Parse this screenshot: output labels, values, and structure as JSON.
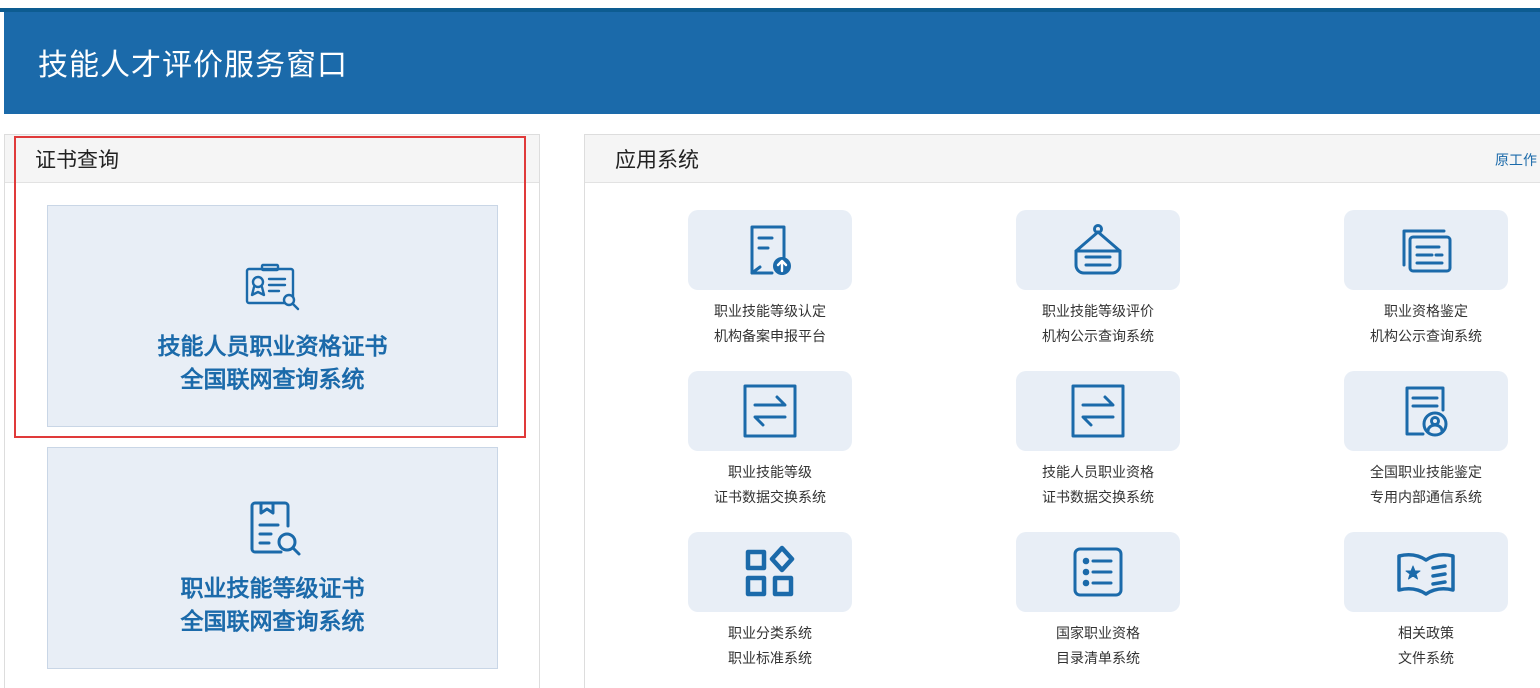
{
  "header": {
    "title": "技能人才评价服务窗口"
  },
  "cert_panel": {
    "title": "证书查询",
    "cards": [
      {
        "line1": "技能人员职业资格证书",
        "line2": "全国联网查询系统",
        "icon": "certificate-search-icon"
      },
      {
        "line1": "职业技能等级证书",
        "line2": "全国联网查询系统",
        "icon": "document-search-icon"
      }
    ]
  },
  "apps_panel": {
    "title": "应用系统",
    "link": "原工作",
    "items": [
      {
        "line1": "职业技能等级认定",
        "line2": "机构备案申报平台",
        "icon": "document-upload-icon"
      },
      {
        "line1": "职业技能等级评价",
        "line2": "机构公示查询系统",
        "icon": "hanging-sign-icon"
      },
      {
        "line1": "职业资格鉴定",
        "line2": "机构公示查询系统",
        "icon": "stacked-documents-icon"
      },
      {
        "line1": "职业技能等级",
        "line2": "证书数据交换系统",
        "icon": "exchange-arrows-icon"
      },
      {
        "line1": "技能人员职业资格",
        "line2": "证书数据交换系统",
        "icon": "exchange-arrows-icon"
      },
      {
        "line1": "全国职业技能鉴定",
        "line2": "专用内部通信系统",
        "icon": "user-document-icon"
      },
      {
        "line1": "职业分类系统",
        "line2": "职业标准系统",
        "icon": "category-grid-icon"
      },
      {
        "line1": "国家职业资格",
        "line2": "目录清单系统",
        "icon": "list-icon"
      },
      {
        "line1": "相关政策",
        "line2": "文件系统",
        "icon": "policy-book-icon"
      }
    ]
  },
  "colors": {
    "header": "#1b6aaa",
    "accent": "#1b6aaa",
    "tile": "#e8eef6",
    "highlight": "#e03a3a"
  }
}
